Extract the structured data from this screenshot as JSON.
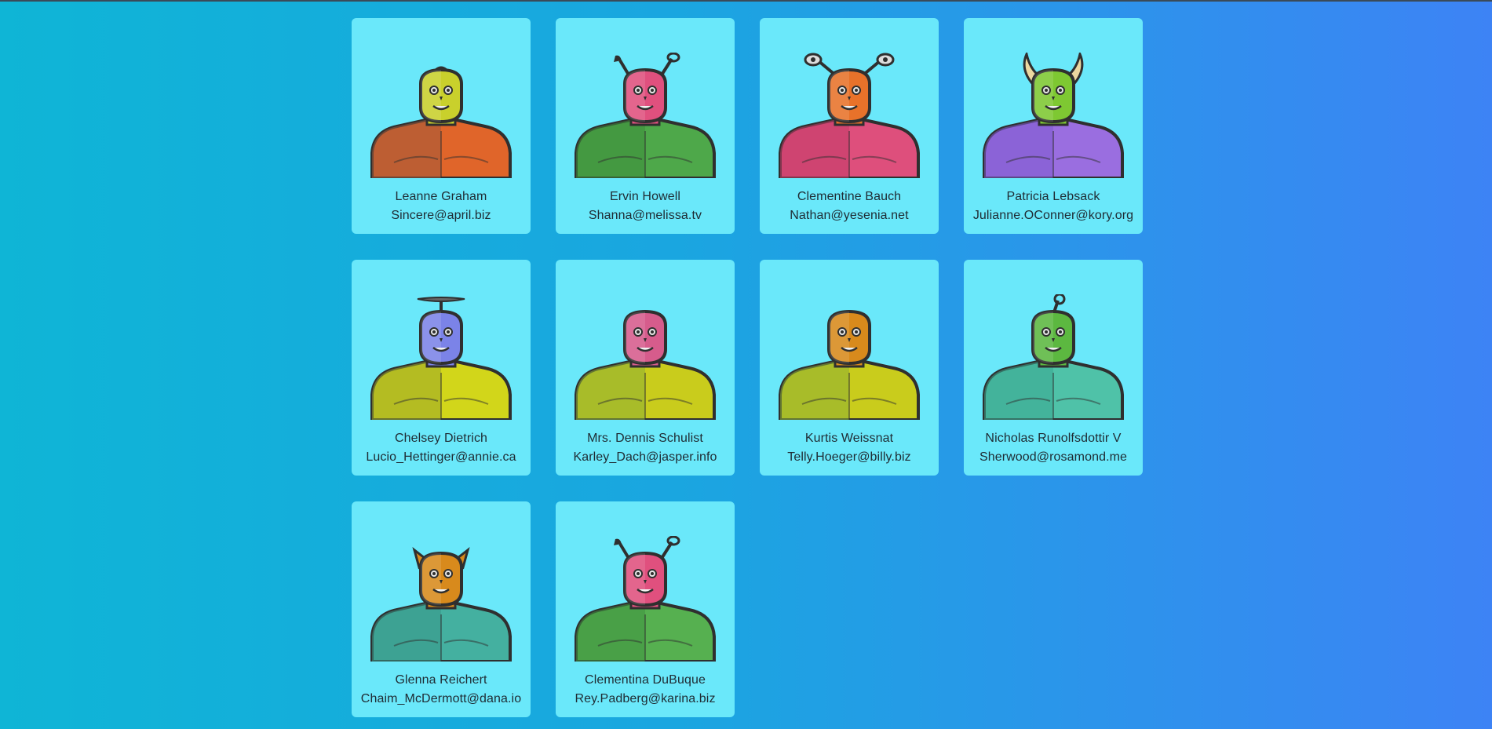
{
  "robots": [
    {
      "name": "Leanne Graham",
      "email": "Sincere@april.biz",
      "head": "#c9d02c",
      "body": "#e0652a",
      "body2": "#a05a3a",
      "feature": "mohawk",
      "icon": "robot-avatar-icon"
    },
    {
      "name": "Ervin Howell",
      "email": "Shanna@melissa.tv",
      "head": "#e0507e",
      "body": "#4ea84a",
      "body2": "#3c8c3a",
      "feature": "antennae",
      "icon": "robot-avatar-icon"
    },
    {
      "name": "Clementine Bauch",
      "email": "Nathan@yesenia.net",
      "head": "#e8722a",
      "body": "#de4f7c",
      "body2": "#c23c68",
      "feature": "eyestalks",
      "icon": "robot-avatar-icon"
    },
    {
      "name": "Patricia Lebsack",
      "email": "Julianne.OConner@kory.org",
      "head": "#7ec832",
      "body": "#9a6ee0",
      "body2": "#7f5bd0",
      "feature": "horns",
      "icon": "robot-avatar-icon"
    },
    {
      "name": "Chelsey Dietrich",
      "email": "Lucio_Hettinger@annie.ca",
      "head": "#7b83e8",
      "body": "#d2d61a",
      "body2": "#9aa82a",
      "feature": "propeller",
      "icon": "robot-avatar-icon"
    },
    {
      "name": "Mrs. Dennis Schulist",
      "email": "Karley_Dach@jasper.info",
      "head": "#d65c8c",
      "body": "#c9cc1c",
      "body2": "#8cae34",
      "feature": "none",
      "icon": "robot-avatar-icon"
    },
    {
      "name": "Kurtis Weissnat",
      "email": "Telly.Hoeger@billy.biz",
      "head": "#d88a1c",
      "body": "#c9cc1c",
      "body2": "#8cae34",
      "feature": "none",
      "icon": "robot-avatar-icon"
    },
    {
      "name": "Nicholas Runolfsdottir V",
      "email": "Sherwood@rosamond.me",
      "head": "#5cb840",
      "body": "#4fc2a8",
      "body2": "#3aa890",
      "feature": "eyestalk",
      "icon": "robot-avatar-icon"
    },
    {
      "name": "Glenna Reichert",
      "email": "Chaim_McDermott@dana.io",
      "head": "#d88a1c",
      "body": "#44b0a0",
      "body2": "#389888",
      "feature": "ears",
      "icon": "robot-avatar-icon"
    },
    {
      "name": "Clementina DuBuque",
      "email": "Rey.Padberg@karina.biz",
      "head": "#e0507e",
      "body": "#56b050",
      "body2": "#3f9440",
      "feature": "antennae",
      "icon": "robot-avatar-icon"
    }
  ]
}
